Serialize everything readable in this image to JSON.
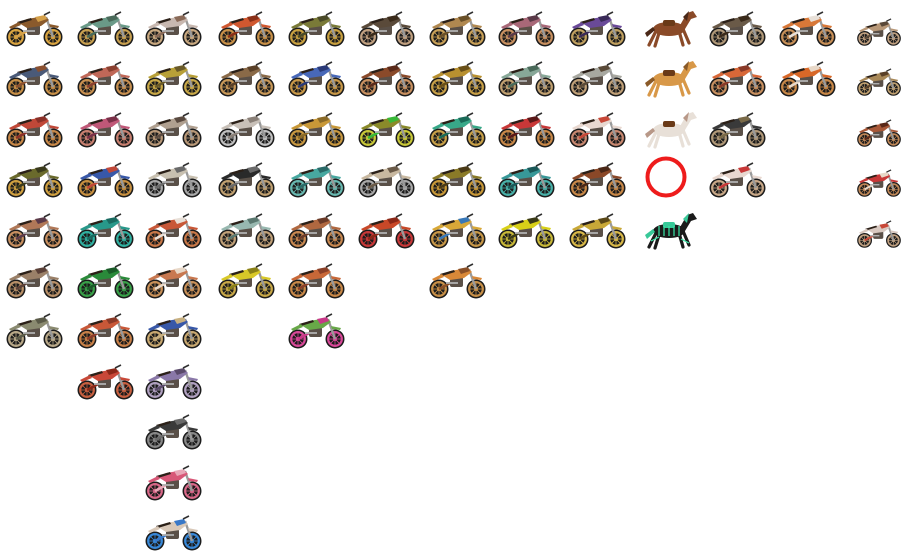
{
  "title": "",
  "selected": {
    "column": 9,
    "row": 3
  },
  "colors": {
    "selection_ring": "#ee1c1c",
    "tire": "#1c1c1c",
    "seat": "#2b2018"
  },
  "columns": [
    {
      "id": "col-1",
      "items": [
        {
          "name": "bike",
          "frame": "#8a5a2c",
          "accent": "#d4a04a",
          "rim": "#d9a441",
          "kind": "bike"
        },
        {
          "name": "bike",
          "frame": "#4a5a78",
          "accent": "#8a5030",
          "rim": "#c89048",
          "kind": "bike"
        },
        {
          "name": "bike",
          "frame": "#c04838",
          "accent": "#8a3028",
          "rim": "#c88848",
          "kind": "bike"
        },
        {
          "name": "bike",
          "frame": "#6a6a2c",
          "accent": "#3a3a1c",
          "rim": "#d0a040",
          "kind": "bike"
        },
        {
          "name": "bike",
          "frame": "#b07858",
          "accent": "#5a3a4a",
          "rim": "#c89060",
          "kind": "bike"
        },
        {
          "name": "bike",
          "frame": "#9a8068",
          "accent": "#5a4038",
          "rim": "#b89068",
          "kind": "bike"
        },
        {
          "name": "bike",
          "frame": "#8a8a70",
          "accent": "#5a5a48",
          "rim": "#b8a888",
          "kind": "bike"
        }
      ]
    },
    {
      "id": "col-2",
      "items": [
        {
          "name": "bike",
          "frame": "#6a9a88",
          "accent": "#4a6a5a",
          "rim": "#c8a050",
          "kind": "bike"
        },
        {
          "name": "bike",
          "frame": "#c06858",
          "accent": "#8a4030",
          "rim": "#c89050",
          "kind": "bike"
        },
        {
          "name": "bike",
          "frame": "#c05878",
          "accent": "#7a3048",
          "rim": "#c88070",
          "kind": "bike"
        },
        {
          "name": "bike",
          "frame": "#3858a8",
          "accent": "#c04838",
          "rim": "#c89040",
          "kind": "bike"
        },
        {
          "name": "bike",
          "frame": "#28988a",
          "accent": "#1a6a60",
          "rim": "#30b0a0",
          "kind": "bike"
        },
        {
          "name": "bike",
          "frame": "#2a8a3a",
          "accent": "#1a5a28",
          "rim": "#38a048",
          "kind": "bike"
        },
        {
          "name": "bike",
          "frame": "#c85838",
          "accent": "#8a3a28",
          "rim": "#c88048",
          "kind": "bike"
        },
        {
          "name": "bike",
          "frame": "#c84838",
          "accent": "#8a2818",
          "rim": "#c86040",
          "kind": "bike"
        }
      ]
    },
    {
      "id": "col-3",
      "items": [
        {
          "name": "bike",
          "frame": "#c8b8b0",
          "accent": "#8a6a58",
          "rim": "#c8a880",
          "kind": "bike"
        },
        {
          "name": "bike",
          "frame": "#b8a038",
          "accent": "#6a5a28",
          "rim": "#c8a848",
          "kind": "bike"
        },
        {
          "name": "bike",
          "frame": "#b0a090",
          "accent": "#5a4a40",
          "rim": "#b89878",
          "kind": "bike"
        },
        {
          "name": "bike",
          "frame": "#c8c0b0",
          "accent": "#6a6a6a",
          "rim": "#a8a8a8",
          "kind": "bike"
        },
        {
          "name": "bike",
          "frame": "#c85838",
          "accent": "#e8e0d8",
          "rim": "#c87848",
          "kind": "bike"
        },
        {
          "name": "bike",
          "frame": "#c87850",
          "accent": "#e8d8c8",
          "rim": "#c89058",
          "kind": "bike"
        },
        {
          "name": "bike",
          "frame": "#3858a8",
          "accent": "#c8b080",
          "rim": "#c8a870",
          "kind": "bike"
        },
        {
          "name": "bike",
          "frame": "#8a78a8",
          "accent": "#5a4a6a",
          "rim": "#b0a0c0",
          "kind": "bike"
        },
        {
          "name": "bike",
          "frame": "#3a3a3a",
          "accent": "#6a6a6a",
          "rim": "#888888",
          "kind": "bike"
        },
        {
          "name": "bike",
          "frame": "#d85878",
          "accent": "#e8a8b8",
          "rim": "#d86888",
          "kind": "bike"
        },
        {
          "name": "bike",
          "frame": "#d8c8b8",
          "accent": "#3878c8",
          "rim": "#3888d8",
          "kind": "bike"
        }
      ]
    },
    {
      "id": "col-4",
      "items": [
        {
          "name": "bike",
          "frame": "#d05830",
          "accent": "#8a3018",
          "rim": "#c89048",
          "kind": "bike"
        },
        {
          "name": "bike",
          "frame": "#8a6a48",
          "accent": "#5a4028",
          "rim": "#c89858",
          "kind": "bike"
        },
        {
          "name": "bike",
          "frame": "#c8c0b8",
          "accent": "#8a8078",
          "rim": "#c0c0c0",
          "kind": "bike"
        },
        {
          "name": "bike",
          "frame": "#2a2a2a",
          "accent": "#6a6a6a",
          "rim": "#c0a070",
          "kind": "bike"
        },
        {
          "name": "bike",
          "frame": "#98b8b0",
          "accent": "#5a7870",
          "rim": "#c0a078",
          "kind": "bike"
        },
        {
          "name": "bike",
          "frame": "#d8c828",
          "accent": "#8a8018",
          "rim": "#c8a848",
          "kind": "bike"
        }
      ]
    },
    {
      "id": "col-5",
      "items": [
        {
          "name": "bike",
          "frame": "#7a7a38",
          "accent": "#4a4a28",
          "rim": "#c8a040",
          "kind": "bike"
        },
        {
          "name": "bike",
          "frame": "#4868b8",
          "accent": "#2a3a78",
          "rim": "#c89848",
          "kind": "bike"
        },
        {
          "name": "bike",
          "frame": "#c89838",
          "accent": "#8a6a28",
          "rim": "#c89840",
          "kind": "bike"
        },
        {
          "name": "bike",
          "frame": "#48a8a0",
          "accent": "#2a6a68",
          "rim": "#68b8b0",
          "kind": "bike"
        },
        {
          "name": "bike",
          "frame": "#b06840",
          "accent": "#6a3a28",
          "rim": "#c88850",
          "kind": "bike"
        },
        {
          "name": "bike",
          "frame": "#c86838",
          "accent": "#8a4028",
          "rim": "#c88848",
          "kind": "bike"
        },
        {
          "name": "bike",
          "frame": "#68a848",
          "accent": "#c83888",
          "rim": "#d84898",
          "kind": "bike"
        }
      ]
    },
    {
      "id": "col-6",
      "items": [
        {
          "name": "bike",
          "frame": "#5a4a3a",
          "accent": "#3a2a1a",
          "rim": "#c0a080",
          "kind": "bike"
        },
        {
          "name": "bike",
          "frame": "#8a4a2a",
          "accent": "#5a2a1a",
          "rim": "#c89060",
          "kind": "bike"
        },
        {
          "name": "bike",
          "frame": "#8a8a2a",
          "accent": "#38b838",
          "rim": "#c8c838",
          "kind": "bike"
        },
        {
          "name": "bike",
          "frame": "#c8b8a0",
          "accent": "#6a5a48",
          "rim": "#a8a8a8",
          "kind": "bike"
        },
        {
          "name": "bike",
          "frame": "#c84828",
          "accent": "#8a2818",
          "rim": "#c83838",
          "kind": "bike"
        }
      ]
    },
    {
      "id": "col-7",
      "items": [
        {
          "name": "bike",
          "frame": "#b08850",
          "accent": "#6a5028",
          "rim": "#c8a058",
          "kind": "bike"
        },
        {
          "name": "bike",
          "frame": "#b89030",
          "accent": "#6a5018",
          "rim": "#c8a048",
          "kind": "bike"
        },
        {
          "name": "bike",
          "frame": "#38a888",
          "accent": "#1a6a58",
          "rim": "#c8a048",
          "kind": "bike"
        },
        {
          "name": "bike",
          "frame": "#8a7a28",
          "accent": "#4a3a18",
          "rim": "#c89838",
          "kind": "bike"
        },
        {
          "name": "bike",
          "frame": "#d8a838",
          "accent": "#3878b8",
          "rim": "#c89848",
          "kind": "bike"
        },
        {
          "name": "bike",
          "frame": "#d88838",
          "accent": "#8a5028",
          "rim": "#c89048",
          "kind": "bike"
        }
      ]
    },
    {
      "id": "col-8",
      "items": [
        {
          "name": "bike",
          "frame": "#a86878",
          "accent": "#5a3a48",
          "rim": "#c89060",
          "kind": "bike"
        },
        {
          "name": "bike",
          "frame": "#88a898",
          "accent": "#4a6a5a",
          "rim": "#c0a070",
          "kind": "bike"
        },
        {
          "name": "bike",
          "frame": "#c83838",
          "accent": "#5a1818",
          "rim": "#c88848",
          "kind": "bike"
        },
        {
          "name": "bike",
          "frame": "#389898",
          "accent": "#1a5858",
          "rim": "#48b0a8",
          "kind": "bike"
        },
        {
          "name": "bike",
          "frame": "#d8d018",
          "accent": "#3a3a18",
          "rim": "#c8b838",
          "kind": "bike"
        }
      ]
    },
    {
      "id": "col-9",
      "items": [
        {
          "name": "bike",
          "frame": "#6a4a98",
          "accent": "#3a2a58",
          "rim": "#c0a060",
          "kind": "bike"
        },
        {
          "name": "bike",
          "frame": "#a8a8a0",
          "accent": "#5a4a38",
          "rim": "#c0a078",
          "kind": "bike"
        },
        {
          "name": "bike",
          "frame": "#e8d8d0",
          "accent": "#c84838",
          "rim": "#c88870",
          "kind": "bike"
        },
        {
          "name": "bike",
          "frame": "#8a4828",
          "accent": "#4a2818",
          "rim": "#c88848",
          "kind": "bike"
        },
        {
          "name": "bike",
          "frame": "#c8a838",
          "accent": "#5a4818",
          "rim": "#d8b848",
          "kind": "bike"
        }
      ]
    },
    {
      "id": "col-10",
      "items": [
        {
          "name": "horse",
          "frame": "#8a4a28",
          "accent": "#4a2818",
          "rim": "#8a4a28",
          "kind": "horse"
        },
        {
          "name": "horse",
          "frame": "#d89848",
          "accent": "#8a5a28",
          "rim": "#d89848",
          "kind": "horse"
        },
        {
          "name": "horse",
          "frame": "#e8e0d8",
          "accent": "#b89888",
          "rim": "#e8e0d8",
          "kind": "horse"
        },
        {
          "name": "selection-ring",
          "frame": "",
          "accent": "",
          "rim": "",
          "kind": "ring"
        },
        {
          "name": "horse",
          "frame": "#1a1a1a",
          "accent": "#38c898",
          "rim": "#1a1a1a",
          "kind": "horse-skeleton"
        }
      ]
    },
    {
      "id": "col-11",
      "items": [
        {
          "name": "bike",
          "frame": "#6a5a48",
          "accent": "#3a2a1a",
          "rim": "#b09878",
          "kind": "bike"
        },
        {
          "name": "bike",
          "frame": "#d86838",
          "accent": "#8a3a28",
          "rim": "#c89060",
          "kind": "bike"
        },
        {
          "name": "bike",
          "frame": "#3a3a3a",
          "accent": "#7a6a48",
          "rim": "#b09878",
          "kind": "bike"
        },
        {
          "name": "bike",
          "frame": "#e8d8d0",
          "accent": "#c83838",
          "rim": "#c8a888",
          "kind": "bike"
        }
      ]
    },
    {
      "id": "col-12",
      "items": [
        {
          "name": "bike",
          "frame": "#d87838",
          "accent": "#e8e0d8",
          "rim": "#c89058",
          "kind": "bike"
        },
        {
          "name": "bike",
          "frame": "#d86828",
          "accent": "#e8d8c8",
          "rim": "#c88848",
          "kind": "bike"
        }
      ]
    },
    {
      "id": "col-13",
      "items": [
        {
          "name": "bike",
          "frame": "#b89878",
          "accent": "#5a4838",
          "rim": "#c0a080",
          "kind": "bike-small"
        },
        {
          "name": "bike",
          "frame": "#a88858",
          "accent": "#5a4028",
          "rim": "#c0a070",
          "kind": "bike-small"
        },
        {
          "name": "bike",
          "frame": "#a85838",
          "accent": "#5a2818",
          "rim": "#c08858",
          "kind": "bike-small"
        },
        {
          "name": "bike",
          "frame": "#c83838",
          "accent": "#e8d8c8",
          "rim": "#c08858",
          "kind": "bike-small"
        },
        {
          "name": "bike",
          "frame": "#d8c8c0",
          "accent": "#c84838",
          "rim": "#c0a080",
          "kind": "bike-small"
        }
      ]
    }
  ]
}
